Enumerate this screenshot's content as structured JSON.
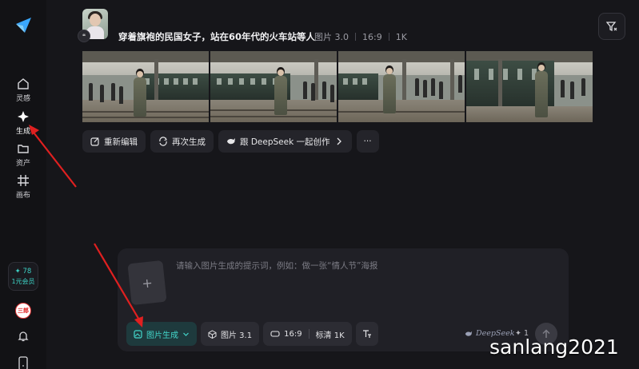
{
  "sidebar": {
    "items": [
      {
        "label": "灵感",
        "icon": "home-icon"
      },
      {
        "label": "生成",
        "icon": "sparkle-icon"
      },
      {
        "label": "资产",
        "icon": "folder-icon"
      },
      {
        "label": "画布",
        "icon": "canvas-icon"
      }
    ],
    "credits_points": "✦ 78",
    "credits_vip": "1元会员",
    "user_badge": "三郎"
  },
  "feed": {
    "avatar_badge": "❝",
    "prompt": "穿着旗袍的民国女子，站在60年代的火车站等人",
    "model": "图片 3.0",
    "ratio": "16:9",
    "resolution": "1K"
  },
  "actions": {
    "reedit": "重新编辑",
    "regenerate": "再次生成",
    "deepseek": "跟 DeepSeek 一起创作",
    "more": "···"
  },
  "composer": {
    "placeholder": "请输入图片生成的提示词，例如：做一张“情人节”海报",
    "mode": "图片生成",
    "model": "图片 3.1",
    "ratio": "16:9",
    "quality": "标清 1K",
    "deepseek_brand": "DeepSeek",
    "cost": "✦ 1"
  },
  "colors": {
    "accent": "#43d6ca",
    "arrow": "#e02020"
  },
  "watermark": "sanlang2021"
}
